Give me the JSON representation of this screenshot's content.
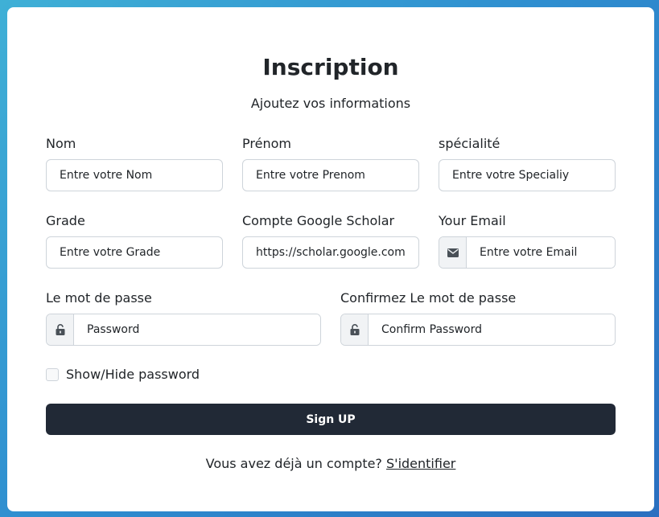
{
  "form": {
    "title": "Inscription",
    "subtitle": "Ajoutez vos informations",
    "fields": {
      "nom": {
        "label": "Nom",
        "placeholder": "Entre votre Nom"
      },
      "prenom": {
        "label": "Prénom",
        "placeholder": "Entre votre Prenom"
      },
      "specialite": {
        "label": "spécialité",
        "placeholder": "Entre votre Specialiy"
      },
      "grade": {
        "label": "Grade",
        "placeholder": "Entre votre Grade"
      },
      "scholar": {
        "label": "Compte Google Scholar",
        "value": "https://scholar.google.com"
      },
      "email": {
        "label": "Your Email",
        "placeholder": "Entre votre Email",
        "icon": "envelope-icon"
      },
      "password": {
        "label": "Le mot de passe",
        "placeholder": "Password",
        "icon": "unlock-icon"
      },
      "confirm": {
        "label": "Confirmez Le mot de passe",
        "placeholder": "Confirm Password",
        "icon": "unlock-icon"
      }
    },
    "show_password_label": "Show/Hide password",
    "signup_label": "Sign UP",
    "footer": {
      "text": "Vous avez déjà un compte? ",
      "link": "S'identifier"
    }
  },
  "colors": {
    "primary_button": "#212936",
    "text": "#212529",
    "border": "#ced4da"
  }
}
